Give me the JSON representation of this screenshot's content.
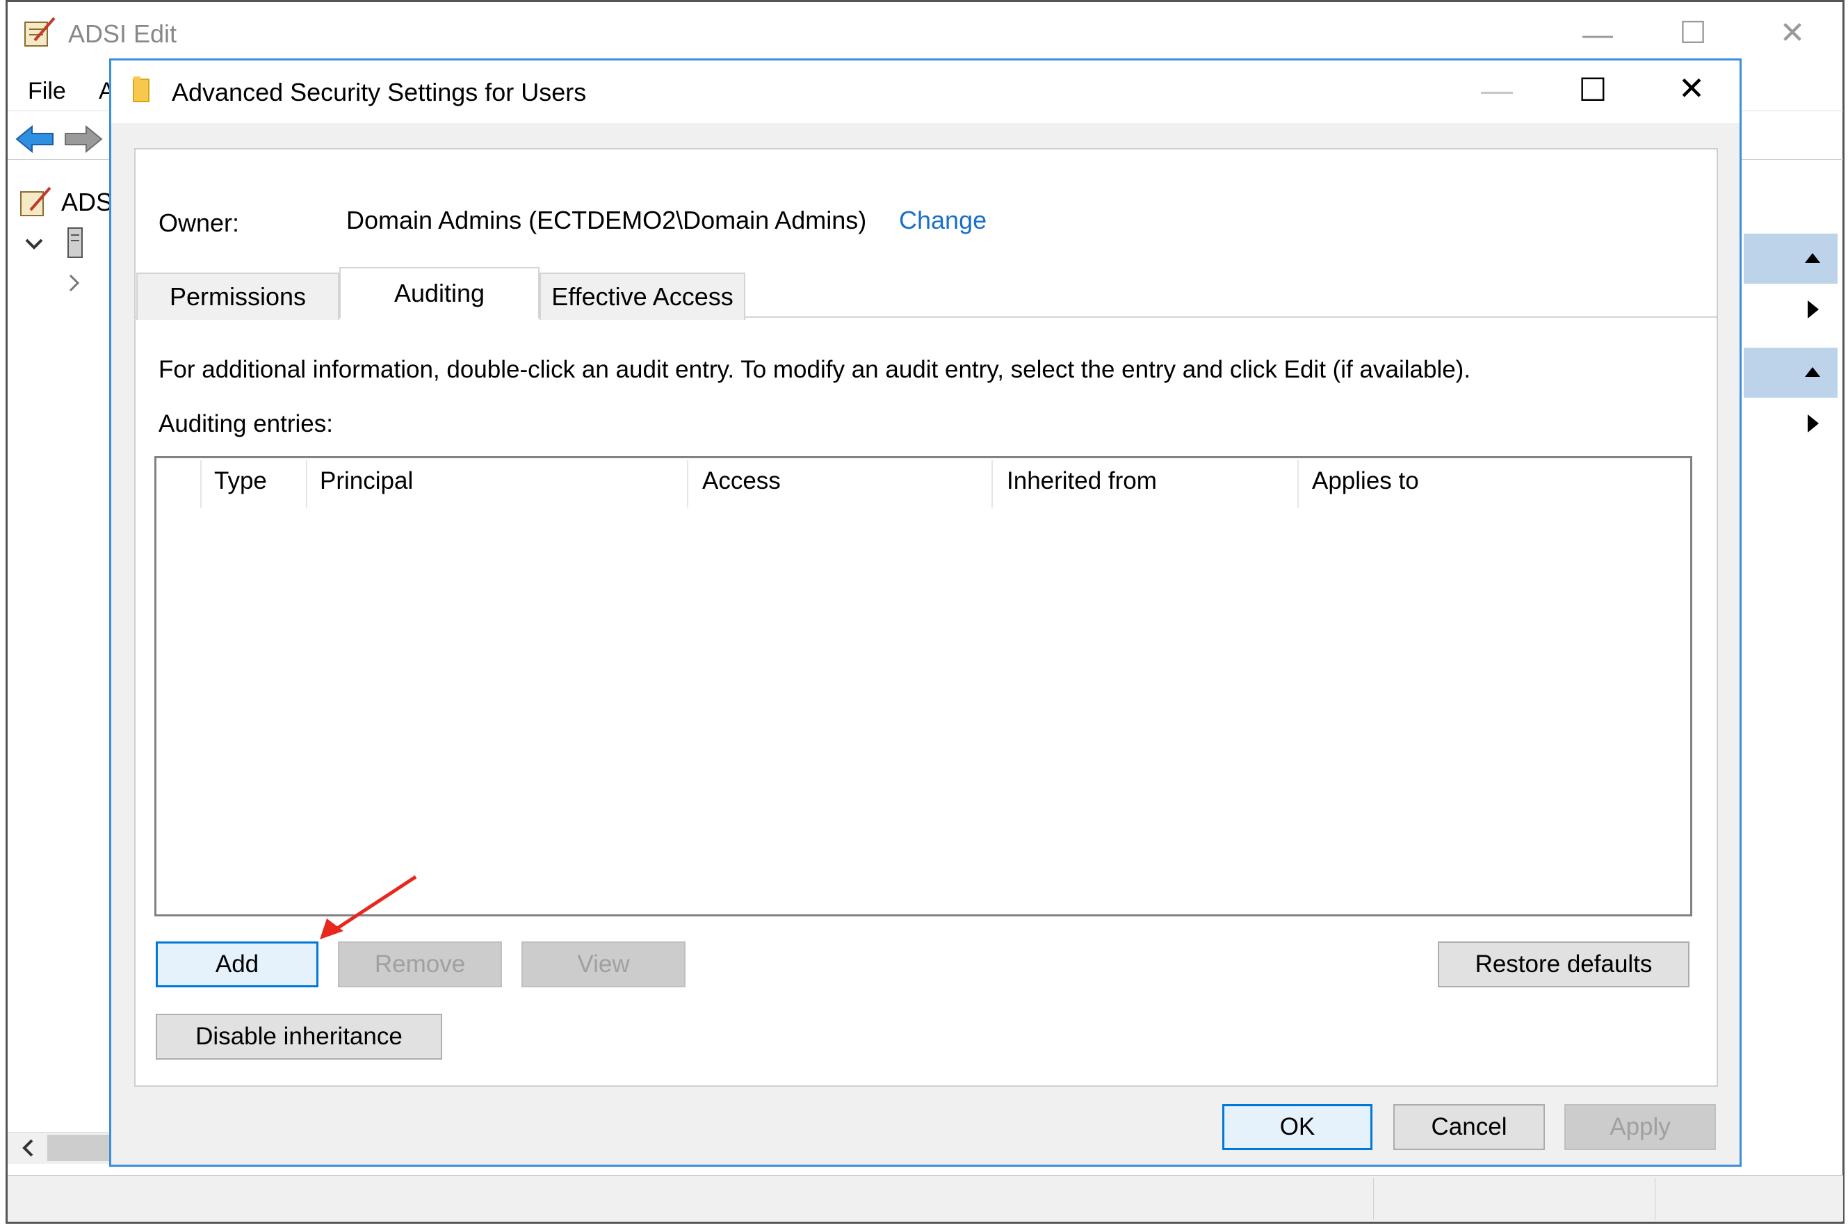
{
  "background_window": {
    "title": "ADSI Edit",
    "menu": {
      "file": "File",
      "action_partial": "A"
    },
    "tree_root_partial": "ADS",
    "controls": {
      "minimize": "—",
      "maximize": "☐",
      "close": "✕"
    }
  },
  "dialog": {
    "title": "Advanced Security Settings for Users",
    "controls": {
      "minimize": "—",
      "maximize": "☐",
      "close": "✕"
    },
    "owner": {
      "label": "Owner:",
      "value": "Domain Admins (ECTDEMO2\\Domain Admins)",
      "change_link": "Change"
    },
    "tabs": [
      {
        "label": "Permissions",
        "selected": false
      },
      {
        "label": "Auditing",
        "selected": true
      },
      {
        "label": "Effective Access",
        "selected": false
      }
    ],
    "info_text": "For additional information, double-click an audit entry. To modify an audit entry, select the entry and click Edit (if available).",
    "entries_label": "Auditing entries:",
    "table": {
      "columns": [
        "Type",
        "Principal",
        "Access",
        "Inherited from",
        "Applies to"
      ],
      "rows": []
    },
    "buttons": {
      "add": "Add",
      "remove": "Remove",
      "view": "View",
      "restore_defaults": "Restore defaults",
      "disable_inheritance": "Disable inheritance",
      "ok": "OK",
      "cancel": "Cancel",
      "apply": "Apply"
    }
  },
  "colors": {
    "dialog_border": "#3c8ede",
    "link": "#1a6fc9",
    "focus_button_border": "#0078d7",
    "annotation_arrow": "#e8281e"
  }
}
